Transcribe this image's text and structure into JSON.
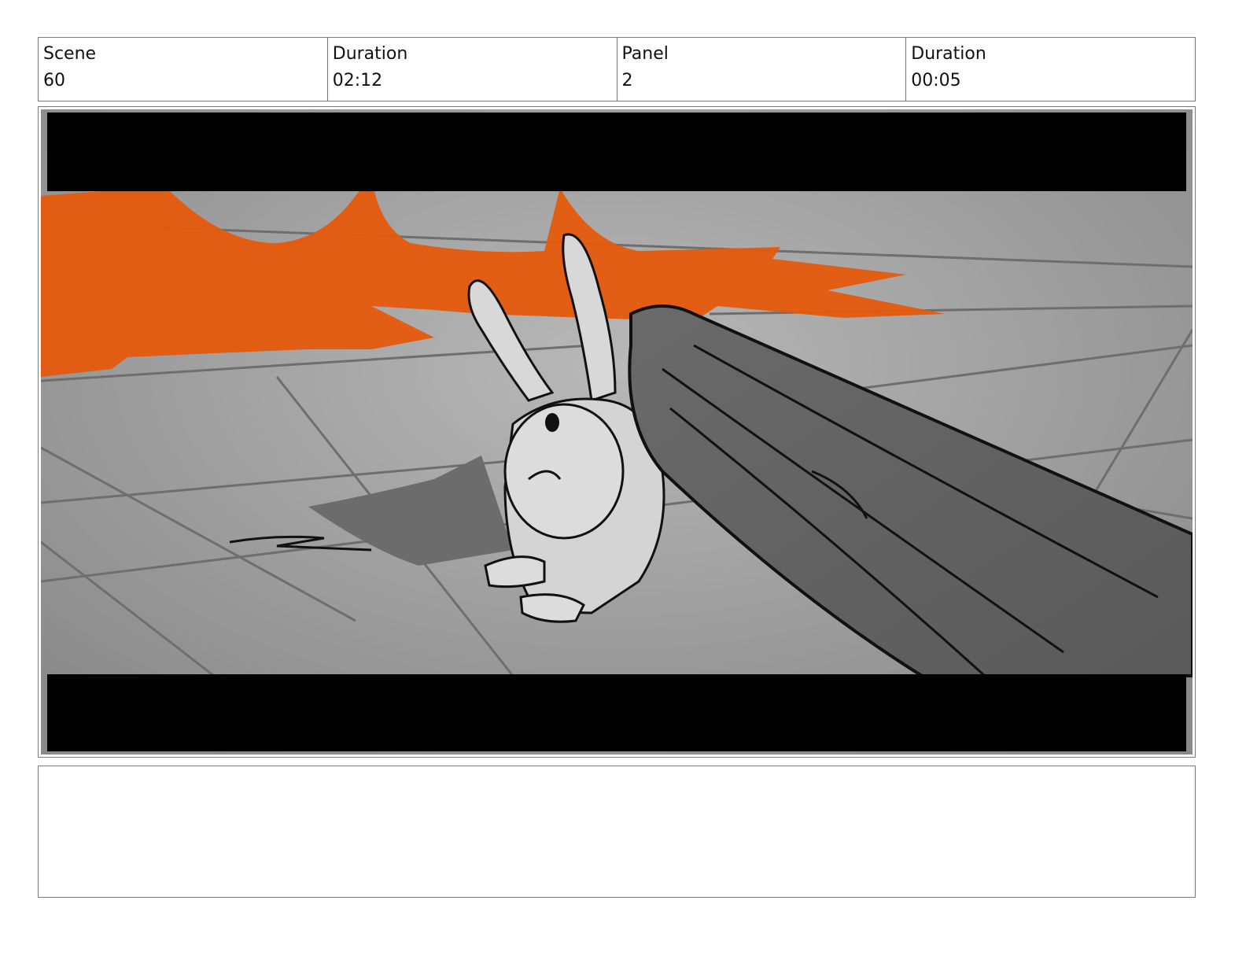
{
  "header": {
    "scene_label": "Scene",
    "scene_value": "60",
    "scene_duration_label": "Duration",
    "scene_duration_value": "02:12",
    "panel_label": "Panel",
    "panel_value": "2",
    "panel_duration_label": "Duration",
    "panel_duration_value": "00:05"
  },
  "colors": {
    "lava": "#e45a0c",
    "floor": "#9a9a9a",
    "letterbox": "#000000"
  },
  "notes": {
    "text": ""
  }
}
